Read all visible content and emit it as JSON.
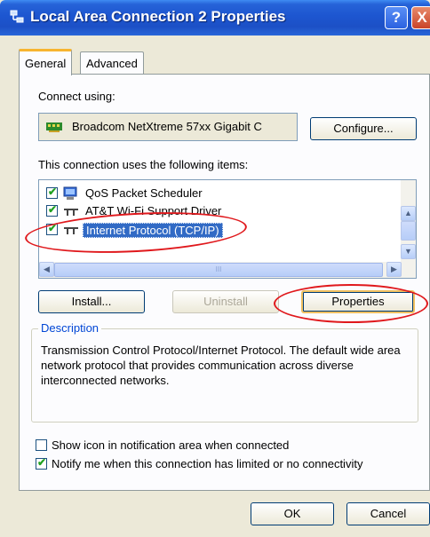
{
  "window": {
    "title": "Local Area Connection 2 Properties",
    "help_label": "?",
    "close_label": "X"
  },
  "tabs": [
    {
      "label": "General"
    },
    {
      "label": "Advanced"
    }
  ],
  "connect_using": {
    "label": "Connect using:",
    "adapter_name": "Broadcom NetXtreme 57xx Gigabit C",
    "configure_label": "Configure..."
  },
  "items_label": "This connection uses the following items:",
  "items": [
    {
      "label": "QoS Packet Scheduler",
      "checked": true,
      "icon": "scheduler-icon"
    },
    {
      "label": "AT&T Wi-Fi Support Driver",
      "checked": true,
      "icon": "network-protocol-icon"
    },
    {
      "label": "Internet Protocol (TCP/IP)",
      "checked": true,
      "icon": "network-protocol-icon",
      "selected": true
    }
  ],
  "scrollbar": {
    "thumb_grip": "III"
  },
  "buttons": {
    "install": "Install...",
    "uninstall": "Uninstall",
    "properties": "Properties"
  },
  "description": {
    "title": "Description",
    "text": "Transmission Control Protocol/Internet Protocol. The default wide area network protocol that provides communication across diverse interconnected networks."
  },
  "options": [
    {
      "label": "Show icon in notification area when connected",
      "checked": false
    },
    {
      "label": "Notify me when this connection has limited or no connectivity",
      "checked": true
    }
  ],
  "footer": {
    "ok": "OK",
    "cancel": "Cancel"
  },
  "colors": {
    "titlebar": "#1d56d0",
    "selection": "#316ac5",
    "annotation": "#e0181c",
    "group_title": "#0046d5"
  }
}
